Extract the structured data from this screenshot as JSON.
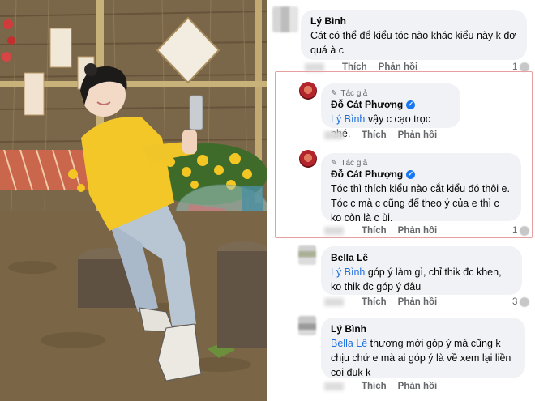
{
  "comments": [
    {
      "name": "Lý Bình",
      "text": "Cát có thể để kiểu tóc nào khác kiểu này k đơ quá à c",
      "actions": {
        "like": "Thích",
        "reply": "Phản hồi"
      },
      "reactions": "1"
    },
    {
      "author_tag": "Tác giả",
      "name": "Đỗ Cát Phượng",
      "mention": "Lý Bình",
      "text": "vậy c cạo trọc nhé.",
      "actions": {
        "like": "Thích",
        "reply": "Phản hồi"
      }
    },
    {
      "author_tag": "Tác giả",
      "name": "Đỗ Cát Phượng",
      "text": "Tóc thì thích kiểu nào cắt kiểu đó thôi e. Tóc c mà c cũng để theo ý của e thì c ko còn là c ùi.",
      "actions": {
        "like": "Thích",
        "reply": "Phản hồi"
      },
      "reactions": "1"
    },
    {
      "name": "Bella Lê",
      "mention": "Lý Bình",
      "text": "góp ý làm gì, chỉ thik đc khen, ko thik đc góp ý đâu",
      "actions": {
        "like": "Thích",
        "reply": "Phản hồi"
      },
      "reactions": "3"
    },
    {
      "name": "Lý Bình",
      "mention": "Bella Lê",
      "text": "thương mới góp ý mà cũng k chịu chứ e mà ai góp ý là về xem lại liền coi đuk k",
      "actions": {
        "like": "Thích",
        "reply": "Phản hồi"
      }
    }
  ],
  "icons": {
    "verified": "verified-badge-icon",
    "author": "pencil-icon",
    "reaction": "reaction-icon"
  },
  "colors": {
    "mention": "#216fdb",
    "bubble": "#f0f2f5",
    "highlight": "#e6a0a0",
    "verified": "#1877f2"
  }
}
